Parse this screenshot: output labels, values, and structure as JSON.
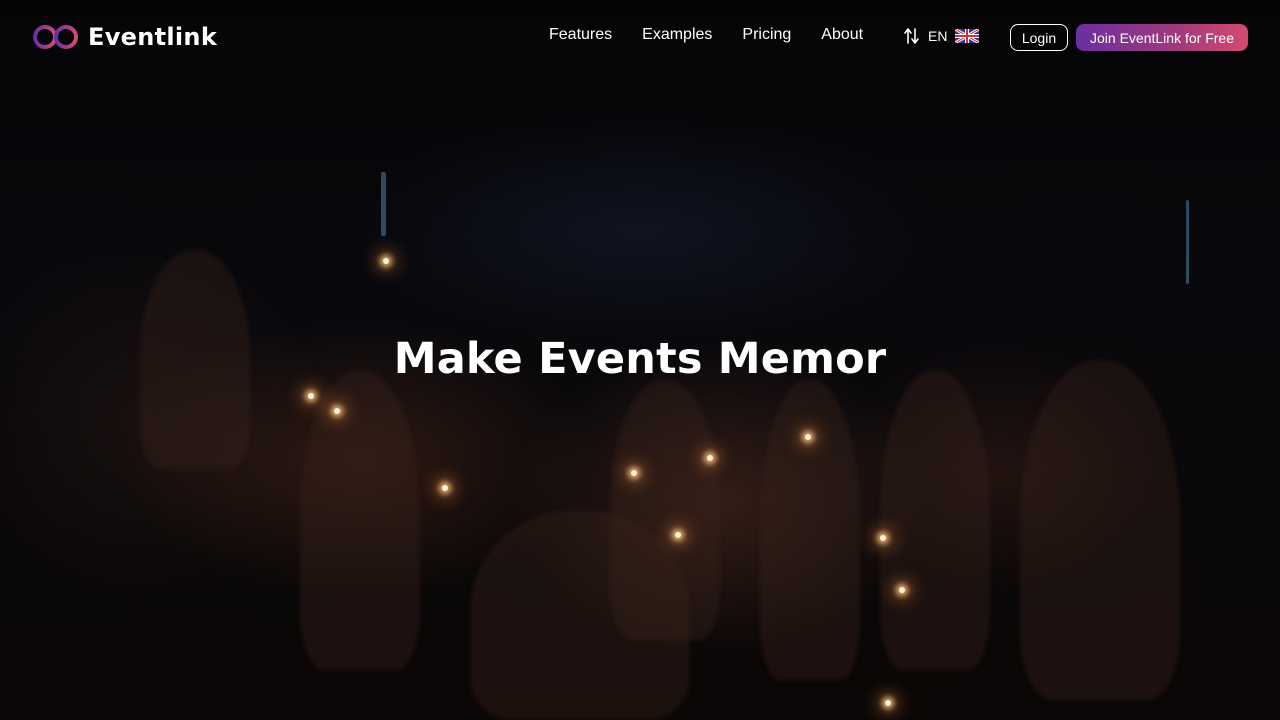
{
  "brand": {
    "name": "Eventlink",
    "logo_icon": "infinity-ring-logo",
    "gradient": [
      "#6a2fa0",
      "#d44b72"
    ]
  },
  "nav": {
    "links": [
      {
        "label": "Features"
      },
      {
        "label": "Examples"
      },
      {
        "label": "Pricing"
      },
      {
        "label": "About"
      }
    ],
    "language": {
      "code": "EN",
      "switch_icon": "swap-arrows-icon",
      "flag_icon": "uk-flag-icon"
    },
    "login_label": "Login",
    "join_label": "Join EventLink for Free",
    "join_colors": [
      "#6a2fa0",
      "#a13a7a",
      "#d44b72"
    ]
  },
  "hero": {
    "headline": "Make Events Memor",
    "background": "dark-party-sparklers-photo"
  }
}
